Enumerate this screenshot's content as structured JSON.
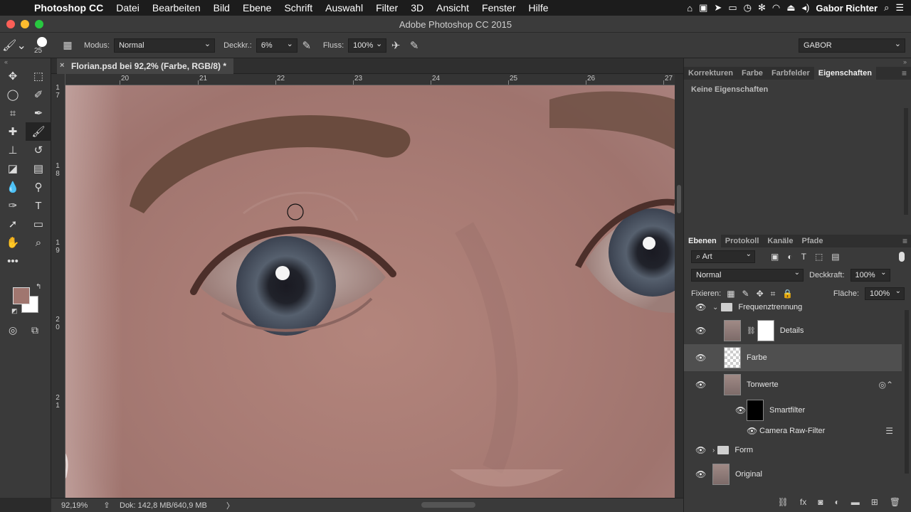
{
  "menubar": {
    "apple": "",
    "items": [
      "Photoshop CC",
      "Datei",
      "Bearbeiten",
      "Bild",
      "Ebene",
      "Schrift",
      "Auswahl",
      "Filter",
      "3D",
      "Ansicht",
      "Fenster",
      "Hilfe"
    ],
    "user": "Gabor Richter"
  },
  "window": {
    "title": "Adobe Photoshop CC 2015"
  },
  "options": {
    "brush_size": "25",
    "mode_label": "Modus:",
    "mode_value": "Normal",
    "opacity_label": "Deckkr.:",
    "opacity_value": "6%",
    "flow_label": "Fluss:",
    "flow_value": "100%",
    "workspace": "GABOR"
  },
  "document": {
    "tab_title": "Florian.psd bei 92,2% (Farbe, RGB/8) *",
    "ruler_h": [
      "20",
      "21",
      "22",
      "23",
      "24",
      "25",
      "26",
      "27"
    ],
    "ruler_v": [
      "1 7",
      "1 8",
      "1 9",
      "2 0",
      "2 1"
    ]
  },
  "status": {
    "zoom": "92,19%",
    "doc": "Dok: 142,8 MB/640,9 MB",
    "arrow": "〉"
  },
  "properties": {
    "tabs": [
      "Korrekturen",
      "Farbe",
      "Farbfelder",
      "Eigenschaften"
    ],
    "empty_text": "Keine Eigenschaften"
  },
  "layers": {
    "tabs": [
      "Ebenen",
      "Protokoll",
      "Kanäle",
      "Pfade"
    ],
    "filter_kind": "Art",
    "blend_mode": "Normal",
    "opacity_label": "Deckkraft:",
    "opacity_value": "100%",
    "lock_label": "Fixieren:",
    "fill_label": "Fläche:",
    "fill_value": "100%",
    "items": [
      {
        "name": "Frequenztrennung"
      },
      {
        "name": "Details"
      },
      {
        "name": "Farbe"
      },
      {
        "name": "Tonwerte"
      },
      {
        "name": "Smartfilter"
      },
      {
        "name": "Camera Raw-Filter"
      },
      {
        "name": "Form"
      },
      {
        "name": "Original"
      }
    ]
  },
  "colors": {
    "foreground": "#a0766f",
    "background": "#ffffff",
    "accent_close": "#fc5f57",
    "accent_min": "#fdbc2e",
    "accent_max": "#28c840"
  }
}
